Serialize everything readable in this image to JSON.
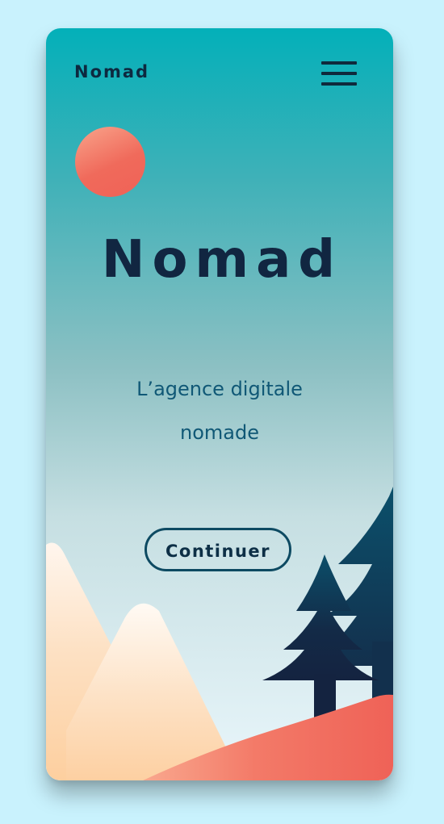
{
  "header": {
    "logo": "Nomad",
    "menu_icon": "hamburger-menu-icon"
  },
  "hero": {
    "title": "Nomad",
    "tagline_line1": "L’agence digitale",
    "tagline_line2": "nomade",
    "cta_label": "Continuer"
  },
  "colors": {
    "page_background": "#c9f2fd",
    "gradient_top": "#03b0b9",
    "gradient_bottom": "#e9f6fb",
    "navy": "#112641",
    "tagline": "#105876",
    "sun": "#f06a5b",
    "mountain": "#fdd3aa",
    "hill": "#ef6257",
    "tree": "#0c4a64"
  }
}
